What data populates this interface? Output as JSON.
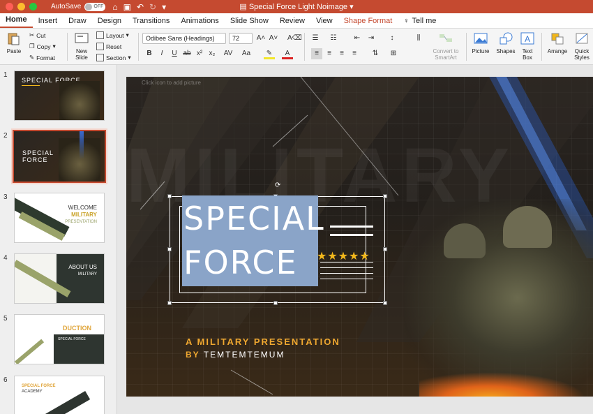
{
  "window": {
    "autosave_label": "AutoSave",
    "autosave_state": "OFF",
    "title": "Special Force Light Noimage"
  },
  "tabs": [
    {
      "label": "Home"
    },
    {
      "label": "Insert"
    },
    {
      "label": "Draw"
    },
    {
      "label": "Design"
    },
    {
      "label": "Transitions"
    },
    {
      "label": "Animations"
    },
    {
      "label": "Slide Show"
    },
    {
      "label": "Review"
    },
    {
      "label": "View"
    },
    {
      "label": "Shape Format"
    }
  ],
  "tell_me": "Tell me",
  "ribbon": {
    "paste": "Paste",
    "cut": "Cut",
    "copy": "Copy",
    "format": "Format",
    "new_slide_line1": "New",
    "new_slide_line2": "Slide",
    "layout": "Layout",
    "reset": "Reset",
    "section": "Section",
    "font_name": "Odibee Sans (Headings)",
    "font_size": "72",
    "convert_line1": "Convert to",
    "convert_line2": "SmartArt",
    "picture": "Picture",
    "shapes": "Shapes",
    "textbox_line1": "Text",
    "textbox_line2": "Box",
    "arrange": "Arrange",
    "quick_line1": "Quick",
    "quick_line2": "Styles"
  },
  "thumbnails": [
    {
      "num": "1",
      "title": "SPECIAL FORCE"
    },
    {
      "num": "2",
      "title_line1": "SPECIAL",
      "title_line2": "FORCE"
    },
    {
      "num": "3",
      "title_line1": "WELCOME",
      "title_line2": "MILITARY",
      "title_line3": "PRESENTATION"
    },
    {
      "num": "4",
      "title_line1": "ABOUT US",
      "title_line2": "MILITARY"
    },
    {
      "num": "5",
      "title": "DUCTION",
      "label": "SPECIAL FORCE"
    },
    {
      "num": "6",
      "title_line1": "SPECIAL FORCE",
      "title_line2": "ACADEMY"
    }
  ],
  "slide": {
    "hint": "Click icon to add picture",
    "background_word": "MILITARY",
    "title_line1": "SPECIAL",
    "title_line2": "FORCE",
    "stars": "★★★★★",
    "subtitle": "A MILITARY PRESENTATION",
    "by": "BY",
    "author": "TEMTEMTEMUM"
  },
  "colors": {
    "accent": "#c54a30",
    "orange_text": "#f0a830",
    "star": "#f2b71c",
    "title_box": "#8aa4c8"
  }
}
